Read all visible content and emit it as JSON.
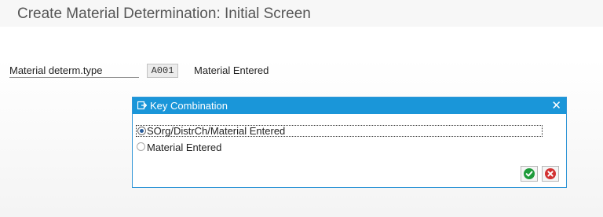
{
  "window": {
    "title": "Create Material Determination: Initial Screen"
  },
  "form": {
    "field_label": "Material determ.type",
    "field_value": "A001",
    "field_description": "Material Entered"
  },
  "dialog": {
    "title": "Key Combination",
    "close_glyph": "✕",
    "options": [
      {
        "label": "SOrg/DistrCh/Material Entered",
        "selected": true
      },
      {
        "label": "Material Entered",
        "selected": false
      }
    ],
    "buttons": {
      "ok_icon": "check-icon",
      "cancel_icon": "cancel-icon"
    }
  },
  "colors": {
    "dialog_header": "#1a96d9",
    "ok_green": "#1e9b3a",
    "cancel_red": "#d23232"
  }
}
